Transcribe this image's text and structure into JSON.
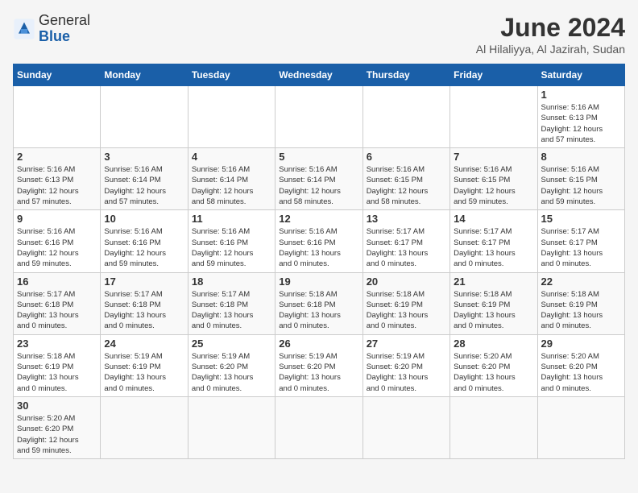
{
  "header": {
    "logo_general": "General",
    "logo_blue": "Blue",
    "title": "June 2024",
    "subtitle": "Al Hilaliyya, Al Jazirah, Sudan"
  },
  "weekdays": [
    "Sunday",
    "Monday",
    "Tuesday",
    "Wednesday",
    "Thursday",
    "Friday",
    "Saturday"
  ],
  "weeks": [
    [
      {
        "day": "",
        "info": ""
      },
      {
        "day": "",
        "info": ""
      },
      {
        "day": "",
        "info": ""
      },
      {
        "day": "",
        "info": ""
      },
      {
        "day": "",
        "info": ""
      },
      {
        "day": "",
        "info": ""
      },
      {
        "day": "1",
        "info": "Sunrise: 5:16 AM\nSunset: 6:13 PM\nDaylight: 12 hours\nand 57 minutes."
      }
    ],
    [
      {
        "day": "2",
        "info": "Sunrise: 5:16 AM\nSunset: 6:13 PM\nDaylight: 12 hours\nand 57 minutes."
      },
      {
        "day": "3",
        "info": "Sunrise: 5:16 AM\nSunset: 6:14 PM\nDaylight: 12 hours\nand 57 minutes."
      },
      {
        "day": "4",
        "info": "Sunrise: 5:16 AM\nSunset: 6:14 PM\nDaylight: 12 hours\nand 58 minutes."
      },
      {
        "day": "5",
        "info": "Sunrise: 5:16 AM\nSunset: 6:14 PM\nDaylight: 12 hours\nand 58 minutes."
      },
      {
        "day": "6",
        "info": "Sunrise: 5:16 AM\nSunset: 6:15 PM\nDaylight: 12 hours\nand 58 minutes."
      },
      {
        "day": "7",
        "info": "Sunrise: 5:16 AM\nSunset: 6:15 PM\nDaylight: 12 hours\nand 59 minutes."
      },
      {
        "day": "8",
        "info": "Sunrise: 5:16 AM\nSunset: 6:15 PM\nDaylight: 12 hours\nand 59 minutes."
      }
    ],
    [
      {
        "day": "9",
        "info": "Sunrise: 5:16 AM\nSunset: 6:16 PM\nDaylight: 12 hours\nand 59 minutes."
      },
      {
        "day": "10",
        "info": "Sunrise: 5:16 AM\nSunset: 6:16 PM\nDaylight: 12 hours\nand 59 minutes."
      },
      {
        "day": "11",
        "info": "Sunrise: 5:16 AM\nSunset: 6:16 PM\nDaylight: 12 hours\nand 59 minutes."
      },
      {
        "day": "12",
        "info": "Sunrise: 5:16 AM\nSunset: 6:16 PM\nDaylight: 13 hours\nand 0 minutes."
      },
      {
        "day": "13",
        "info": "Sunrise: 5:17 AM\nSunset: 6:17 PM\nDaylight: 13 hours\nand 0 minutes."
      },
      {
        "day": "14",
        "info": "Sunrise: 5:17 AM\nSunset: 6:17 PM\nDaylight: 13 hours\nand 0 minutes."
      },
      {
        "day": "15",
        "info": "Sunrise: 5:17 AM\nSunset: 6:17 PM\nDaylight: 13 hours\nand 0 minutes."
      }
    ],
    [
      {
        "day": "16",
        "info": "Sunrise: 5:17 AM\nSunset: 6:18 PM\nDaylight: 13 hours\nand 0 minutes."
      },
      {
        "day": "17",
        "info": "Sunrise: 5:17 AM\nSunset: 6:18 PM\nDaylight: 13 hours\nand 0 minutes."
      },
      {
        "day": "18",
        "info": "Sunrise: 5:17 AM\nSunset: 6:18 PM\nDaylight: 13 hours\nand 0 minutes."
      },
      {
        "day": "19",
        "info": "Sunrise: 5:18 AM\nSunset: 6:18 PM\nDaylight: 13 hours\nand 0 minutes."
      },
      {
        "day": "20",
        "info": "Sunrise: 5:18 AM\nSunset: 6:19 PM\nDaylight: 13 hours\nand 0 minutes."
      },
      {
        "day": "21",
        "info": "Sunrise: 5:18 AM\nSunset: 6:19 PM\nDaylight: 13 hours\nand 0 minutes."
      },
      {
        "day": "22",
        "info": "Sunrise: 5:18 AM\nSunset: 6:19 PM\nDaylight: 13 hours\nand 0 minutes."
      }
    ],
    [
      {
        "day": "23",
        "info": "Sunrise: 5:18 AM\nSunset: 6:19 PM\nDaylight: 13 hours\nand 0 minutes."
      },
      {
        "day": "24",
        "info": "Sunrise: 5:19 AM\nSunset: 6:19 PM\nDaylight: 13 hours\nand 0 minutes."
      },
      {
        "day": "25",
        "info": "Sunrise: 5:19 AM\nSunset: 6:20 PM\nDaylight: 13 hours\nand 0 minutes."
      },
      {
        "day": "26",
        "info": "Sunrise: 5:19 AM\nSunset: 6:20 PM\nDaylight: 13 hours\nand 0 minutes."
      },
      {
        "day": "27",
        "info": "Sunrise: 5:19 AM\nSunset: 6:20 PM\nDaylight: 13 hours\nand 0 minutes."
      },
      {
        "day": "28",
        "info": "Sunrise: 5:20 AM\nSunset: 6:20 PM\nDaylight: 13 hours\nand 0 minutes."
      },
      {
        "day": "29",
        "info": "Sunrise: 5:20 AM\nSunset: 6:20 PM\nDaylight: 13 hours\nand 0 minutes."
      }
    ],
    [
      {
        "day": "30",
        "info": "Sunrise: 5:20 AM\nSunset: 6:20 PM\nDaylight: 12 hours\nand 59 minutes."
      },
      {
        "day": "",
        "info": ""
      },
      {
        "day": "",
        "info": ""
      },
      {
        "day": "",
        "info": ""
      },
      {
        "day": "",
        "info": ""
      },
      {
        "day": "",
        "info": ""
      },
      {
        "day": "",
        "info": ""
      }
    ]
  ]
}
